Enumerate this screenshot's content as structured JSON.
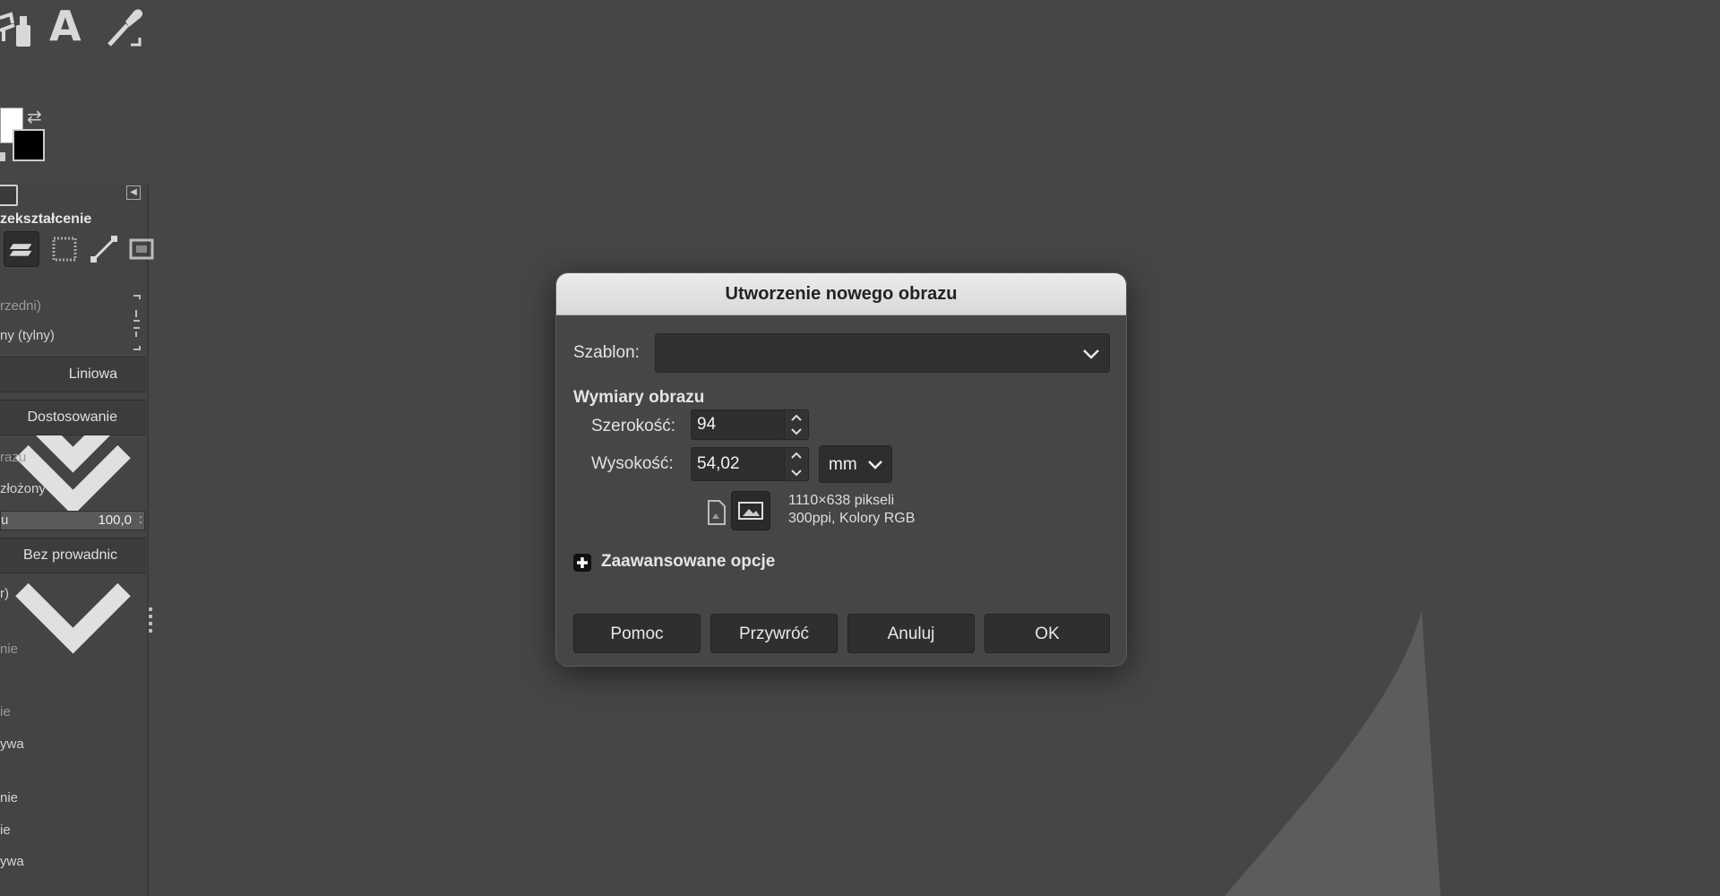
{
  "toolbox": {
    "text_tool_glyph": "A",
    "panel_title": "zekształcenie",
    "rows": {
      "front_back_1": "rzedni)",
      "front_back_2": "ny (tylny)",
      "interpolation": "Liniowa",
      "clipping": "Dostosowanie",
      "preview_label": "razu",
      "preview_value": "złożony",
      "opacity_label": "u",
      "opacity_value": "100,0",
      "guides": "Bez prowadnic",
      "r1": "r)",
      "r2": "nie",
      "r3": "ie",
      "r4": "ywa",
      "r5": "nie",
      "r6": "ie",
      "r7": "ywa"
    }
  },
  "dialog": {
    "title": "Utworzenie nowego obrazu",
    "template_label": "Szablon:",
    "template_value": "",
    "dimensions_title": "Wymiary obrazu",
    "width_label": "Szerokość:",
    "width_value": "94",
    "height_label": "Wysokość:",
    "height_value": "54,02",
    "unit": "mm",
    "info_line1": "1110×638 pikseli",
    "info_line2": "300ppi, Kolory RGB",
    "advanced_label": "Zaawansowane opcje",
    "buttons": {
      "help": "Pomoc",
      "reset": "Przywróć",
      "cancel": "Anuluj",
      "ok": "OK"
    }
  },
  "colors": {
    "canvas": "#464646",
    "foreground": "#ffffff",
    "background": "#000000"
  }
}
